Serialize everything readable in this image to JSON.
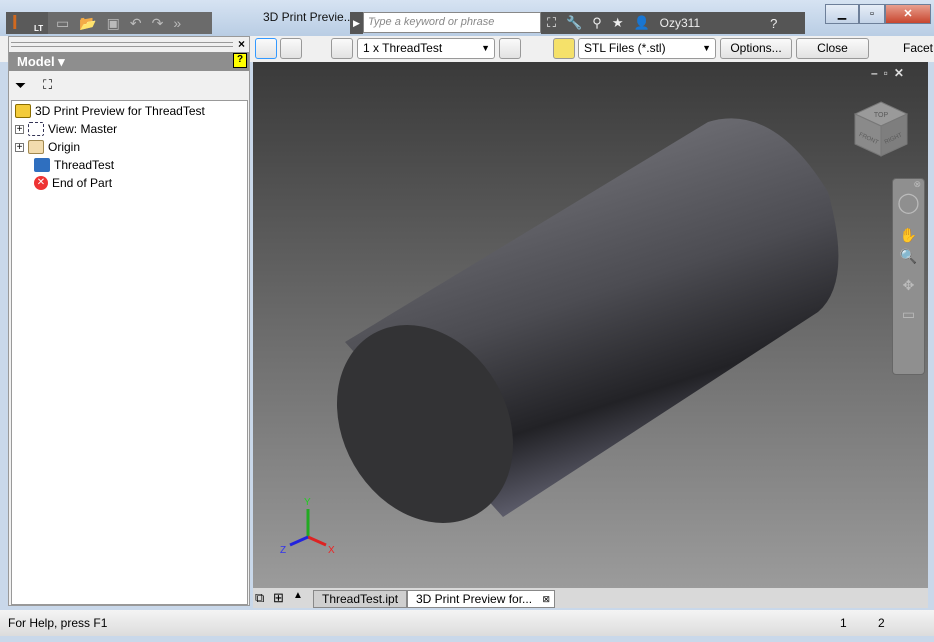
{
  "app": {
    "logo": "I",
    "edition": "LT",
    "title": "3D Print Previe...",
    "search_placeholder": "Type a keyword or phrase",
    "user": "Ozy311"
  },
  "icons": {
    "qat": [
      "new-icon",
      "open-icon",
      "save-icon",
      "undo-icon",
      "redo-icon",
      "more-icon"
    ],
    "strip": [
      "binoculars-icon",
      "key-icon",
      "satellite-icon",
      "star-icon",
      "user-icon",
      "help-icon"
    ]
  },
  "toolbar": {
    "part_select": "1 x ThreadTest",
    "format_select": "STL Files (*.stl)",
    "options_label": "Options...",
    "close_label": "Close",
    "facet_label": "Facet"
  },
  "model_panel": {
    "title": "Model",
    "tree": [
      {
        "label": "3D Print Preview for ThreadTest",
        "icon": "part-icon"
      },
      {
        "label": "View: Master",
        "icon": "view-icon",
        "expandable": true
      },
      {
        "label": "Origin",
        "icon": "folder-icon",
        "expandable": true
      },
      {
        "label": "ThreadTest",
        "icon": "derived-part-icon"
      },
      {
        "label": "End of Part",
        "icon": "end-of-part-icon"
      }
    ]
  },
  "viewcube": {
    "faces": [
      "TOP",
      "FRONT",
      "RIGHT"
    ]
  },
  "axes": {
    "x": "X",
    "y": "Y",
    "z": "Z"
  },
  "tabs": [
    {
      "label": "ThreadTest.ipt",
      "active": false
    },
    {
      "label": "3D Print Preview for...",
      "active": true
    }
  ],
  "status": {
    "help": "For Help, press F1",
    "n1": "1",
    "n2": "2"
  }
}
